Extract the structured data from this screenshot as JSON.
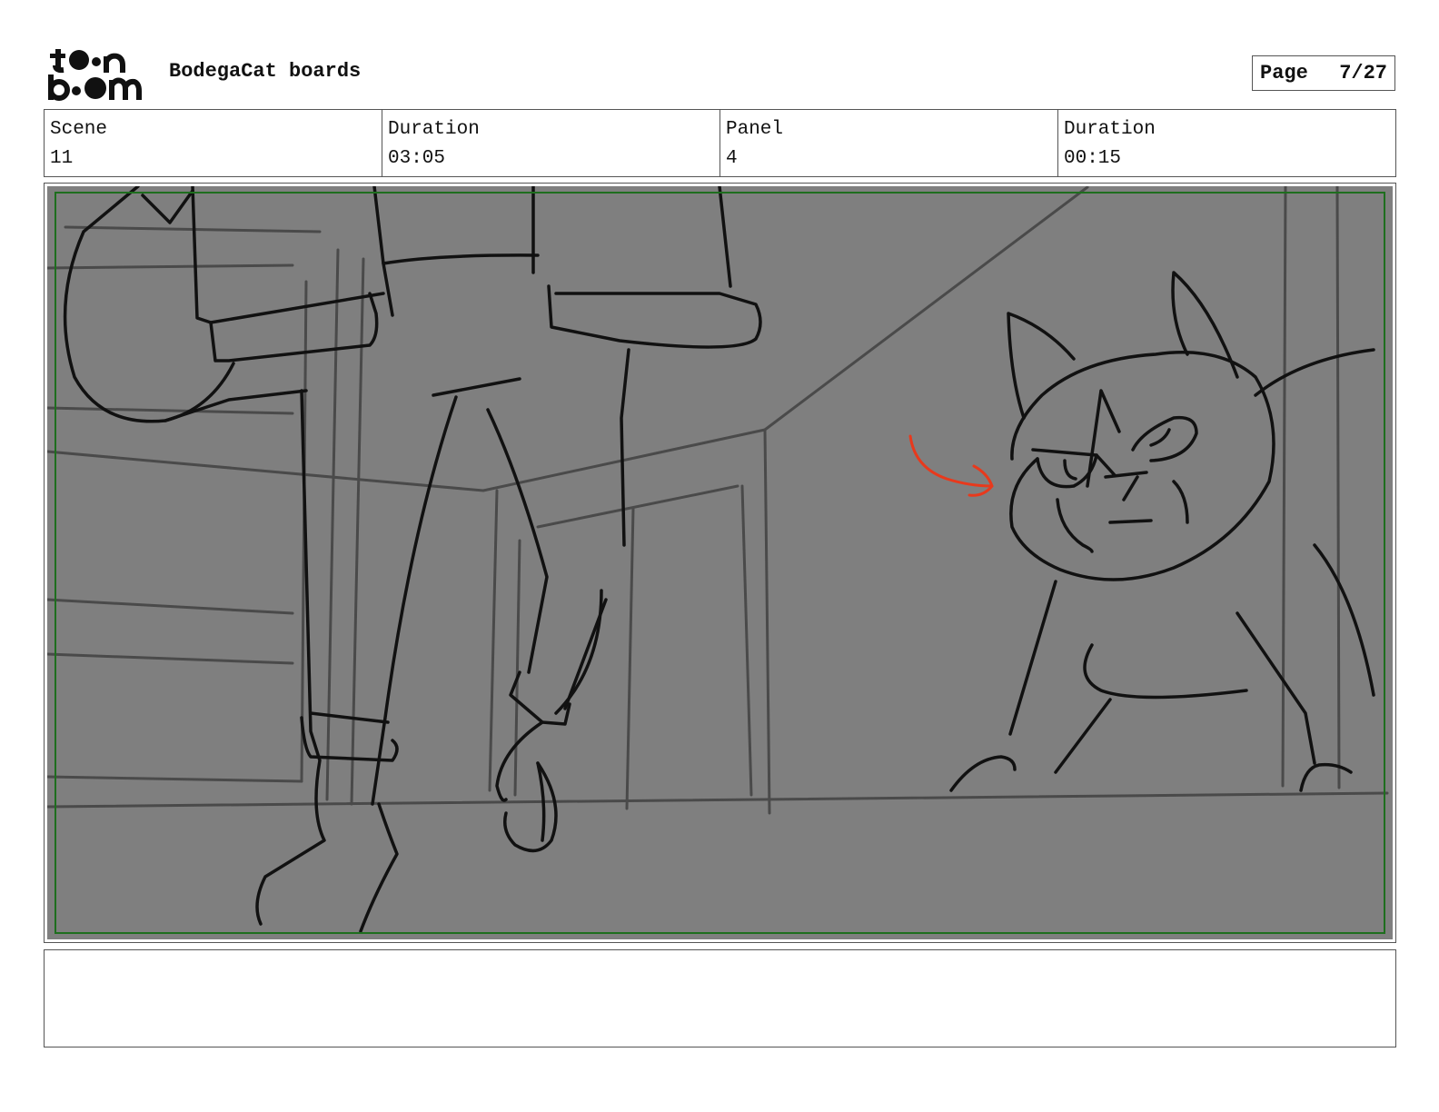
{
  "header": {
    "logo_text": "toon boom",
    "title": "BodegaCat boards",
    "page_label": "Page",
    "page_value": "7/27"
  },
  "info": {
    "scene_label": "Scene",
    "scene_value": "11",
    "scene_duration_label": "Duration",
    "scene_duration_value": "03:05",
    "panel_label": "Panel",
    "panel_value": "4",
    "panel_duration_label": "Duration",
    "panel_duration_value": "00:15"
  },
  "panel": {
    "background_color": "#7f7f7f",
    "safe_frame_color": "#1e6e1e",
    "annotation_arrow_color": "#e8391c"
  },
  "notes": {
    "text": ""
  }
}
